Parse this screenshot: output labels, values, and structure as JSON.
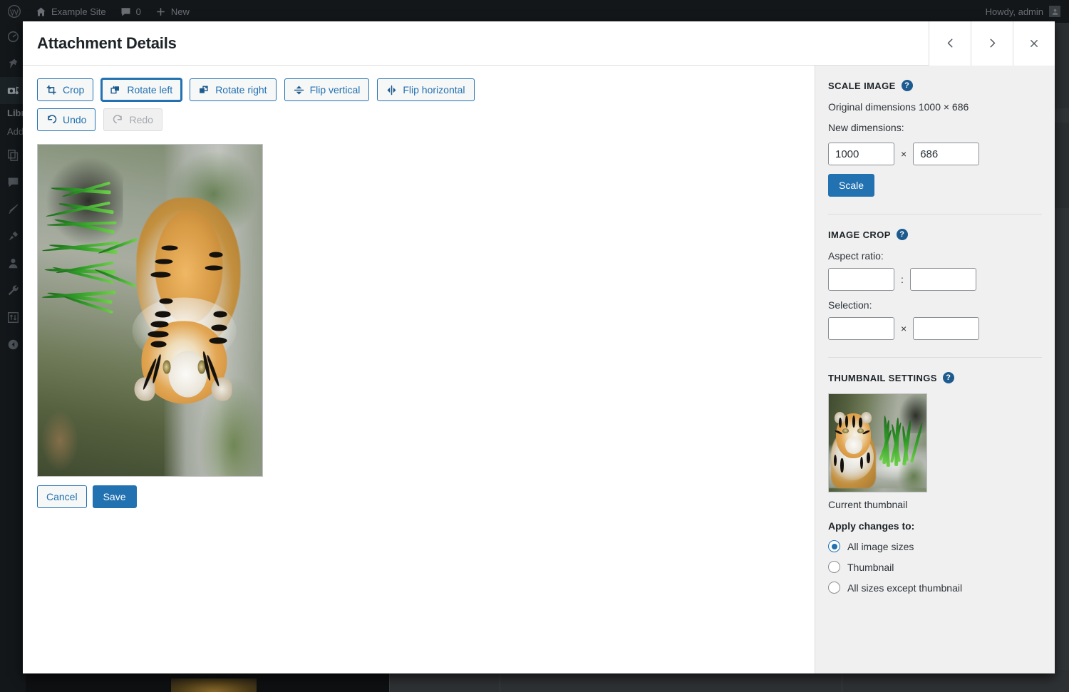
{
  "adminbar": {
    "logo_icon": "wordpress-logo-icon",
    "home_icon": "home-icon",
    "site_name": "Example Site",
    "comments_icon": "comment-bubble-icon",
    "comments_count": "0",
    "new_icon": "plus-icon",
    "new_label": "New",
    "howdy": "Howdy, admin",
    "avatar_icon": "avatar-icon"
  },
  "admin_sidebar": {
    "items": [
      {
        "icon": "dashboard-icon",
        "current": false
      },
      {
        "icon": "pin-posts-icon",
        "current": false
      },
      {
        "icon": "media-camera-icon",
        "current": true
      },
      {
        "icon": "pages-icon",
        "current": false
      },
      {
        "icon": "comments-icon",
        "current": false
      },
      {
        "icon": "appearance-brush-icon",
        "current": false
      },
      {
        "icon": "plugins-plug-icon",
        "current": false
      },
      {
        "icon": "users-icon",
        "current": false
      },
      {
        "icon": "tools-wrench-icon",
        "current": false
      },
      {
        "icon": "settings-sliders-icon",
        "current": false
      },
      {
        "icon": "collapse-menu-icon",
        "current": false
      }
    ],
    "submenu": [
      {
        "label": "Library",
        "current": true
      },
      {
        "label": "Add New Media File",
        "current": false
      }
    ]
  },
  "modal": {
    "title": "Attachment Details",
    "prev_icon": "chevron-left-icon",
    "prev_label": "‹",
    "next_icon": "chevron-right-icon",
    "next_label": "›",
    "close_icon": "close-x-icon",
    "close_label": "✕"
  },
  "editor": {
    "tools_row1": [
      {
        "label": "Crop",
        "icon": "crop-icon",
        "state": "normal"
      },
      {
        "label": "Rotate left",
        "icon": "rotate-left-icon",
        "state": "focused"
      },
      {
        "label": "Rotate right",
        "icon": "rotate-right-icon",
        "state": "normal"
      },
      {
        "label": "Flip vertical",
        "icon": "flip-vertical-icon",
        "state": "normal"
      },
      {
        "label": "Flip horizontal",
        "icon": "flip-horizontal-icon",
        "state": "normal"
      }
    ],
    "tools_row2": [
      {
        "label": "Undo",
        "icon": "undo-icon",
        "state": "normal"
      },
      {
        "label": "Redo",
        "icon": "redo-icon",
        "state": "disabled"
      }
    ],
    "image_alt": "tiger-in-water-rotated-image",
    "cancel_label": "Cancel",
    "save_label": "Save"
  },
  "settings": {
    "scale": {
      "title": "Scale Image",
      "help_glyph": "?",
      "original_dimensions": "Original dimensions 1000 × 686",
      "new_dimensions_label": "New dimensions:",
      "width_value": "1000",
      "height_value": "686",
      "separator": "×",
      "scale_button": "Scale"
    },
    "crop": {
      "title": "Image Crop",
      "help_glyph": "?",
      "aspect_label": "Aspect ratio:",
      "aspect_w": "",
      "aspect_h": "",
      "aspect_separator": ":",
      "selection_label": "Selection:",
      "selection_w": "",
      "selection_h": "",
      "selection_separator": "×"
    },
    "thumbnail": {
      "title": "Thumbnail Settings",
      "help_glyph": "?",
      "preview_alt": "current-thumbnail-tiger-image",
      "caption": "Current thumbnail",
      "apply_label": "Apply changes to:",
      "options": [
        {
          "label": "All image sizes",
          "checked": true
        },
        {
          "label": "Thumbnail",
          "checked": false
        },
        {
          "label": "All sizes except thumbnail",
          "checked": false
        }
      ]
    }
  },
  "colors": {
    "accent_blue": "#2271b1",
    "help_blue": "#1d5b8f",
    "panel_bg": "#f0f0f1",
    "admin_dark": "#1d2327",
    "text": "#2c3338"
  }
}
